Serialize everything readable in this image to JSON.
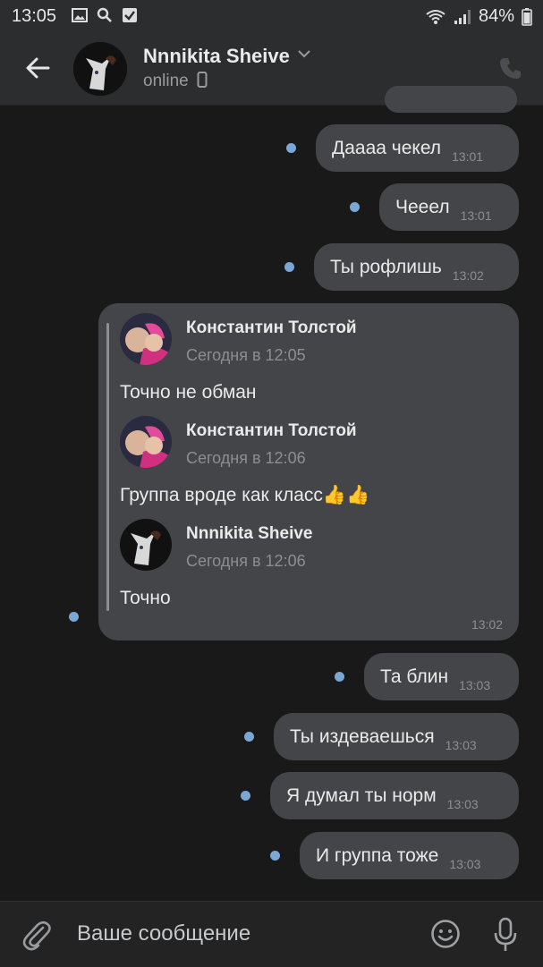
{
  "status_bar": {
    "time": "13:05",
    "battery": "84%"
  },
  "header": {
    "contact_name": "Nnnikita Sheive",
    "status": "online"
  },
  "messages": [
    {
      "text": "Даааа чекел",
      "time": "13:01"
    },
    {
      "text": "Чееел",
      "time": "13:01"
    },
    {
      "text": "Ты рофлишь",
      "time": "13:02"
    }
  ],
  "forward": {
    "time": "13:02",
    "items": [
      {
        "author": "Константин Толстой",
        "date": "Сегодня в 12:05",
        "text": "Точно не обман"
      },
      {
        "author": "Константин Толстой",
        "date": "Сегодня в 12:06",
        "text": "Группа вроде как класс👍👍"
      },
      {
        "author": "Nnnikita Sheive",
        "date": "Сегодня в 12:06",
        "text": "Точно"
      }
    ]
  },
  "messages_after": [
    {
      "text": "Та блин",
      "time": "13:03"
    },
    {
      "text": "Ты издеваешься",
      "time": "13:03"
    },
    {
      "text": "Я думал ты норм",
      "time": "13:03"
    },
    {
      "text": "И группа тоже",
      "time": "13:03"
    }
  ],
  "composer": {
    "placeholder": "Ваше сообщение"
  },
  "colors": {
    "accent_dot": "#7ba7d4",
    "bubble": "#444548",
    "background": "#19191a"
  }
}
